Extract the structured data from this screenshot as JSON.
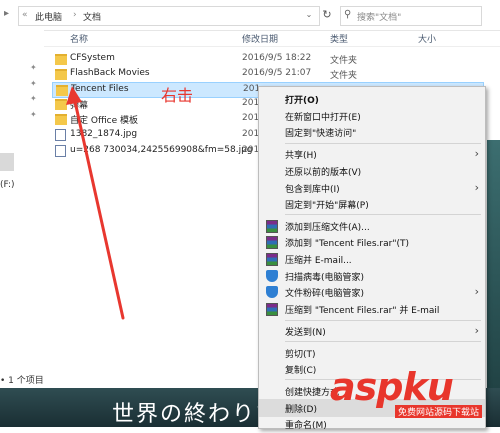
{
  "address": {
    "nav_glyph": "▸",
    "crumbs": [
      "«",
      "此电脑",
      "›",
      "文档"
    ],
    "dropdown_glyph": "⌄",
    "refresh_glyph": "↻"
  },
  "search": {
    "icon": "search-icon",
    "placeholder": "搜索\"文档\""
  },
  "left_pane": {
    "drive_label": "(F:)",
    "status": "• 1 个项目"
  },
  "columns": {
    "name": "名称",
    "modified": "修改日期",
    "type": "类型",
    "size": "大小"
  },
  "files": [
    {
      "name": "CFSystem",
      "modified": "2016/9/5 18:22",
      "type": "文件夹",
      "kind": "folder"
    },
    {
      "name": "FlashBack Movies",
      "modified": "2016/9/5 21:07",
      "type": "文件夹",
      "kind": "folder"
    },
    {
      "name": "Tencent Files",
      "modified": "201",
      "type": "",
      "kind": "folder",
      "selected": true
    },
    {
      "name": "弹幕",
      "modified": "201",
      "type": "",
      "kind": "folder"
    },
    {
      "name": "自定 Office 模板",
      "modified": "201",
      "type": "",
      "kind": "folder"
    },
    {
      "name": "1382_1874.jpg",
      "modified": "201",
      "type": "",
      "kind": "file"
    },
    {
      "name": "u=268 730034,2425569908&fm=58.jpg",
      "modified": "201",
      "type": "",
      "kind": "file"
    }
  ],
  "annotation": {
    "text": "右击",
    "color": "#e8372f"
  },
  "context_menu": {
    "items": [
      {
        "label": "打开(O)",
        "bold": true
      },
      {
        "label": "在新窗口中打开(E)"
      },
      {
        "label": "固定到\"快速访问\""
      },
      {
        "separator": true
      },
      {
        "label": "共享(H)",
        "submenu": true
      },
      {
        "label": "还原以前的版本(V)"
      },
      {
        "label": "包含到库中(I)",
        "submenu": true
      },
      {
        "label": "固定到\"开始\"屏幕(P)"
      },
      {
        "separator": true
      },
      {
        "label": "添加到压缩文件(A)...",
        "icon": "rar"
      },
      {
        "label": "添加到 \"Tencent Files.rar\"(T)",
        "icon": "rar"
      },
      {
        "label": "压缩并 E-mail...",
        "icon": "rar"
      },
      {
        "label": "扫描病毒(电脑管家)",
        "icon": "shield"
      },
      {
        "label": "文件粉碎(电脑管家)",
        "icon": "shield",
        "submenu": true
      },
      {
        "label": "压缩到 \"Tencent Files.rar\" 并 E-mail",
        "icon": "rar"
      },
      {
        "separator": true
      },
      {
        "label": "发送到(N)",
        "submenu": true
      },
      {
        "separator": true
      },
      {
        "label": "剪切(T)"
      },
      {
        "label": "复制(C)"
      },
      {
        "separator": true
      },
      {
        "label": "创建快捷方式"
      },
      {
        "label": "删除(D)",
        "highlighted": true
      },
      {
        "label": "重命名(M)"
      }
    ]
  },
  "overlay": {
    "subtitle": "世界の終わりで",
    "watermark": "aspku",
    "watermark_sub": "免费网站源码下载站"
  },
  "colors": {
    "selection": "#cce8ff",
    "menu_bg": "#f2f2f2",
    "accent_red": "#e8362c"
  }
}
